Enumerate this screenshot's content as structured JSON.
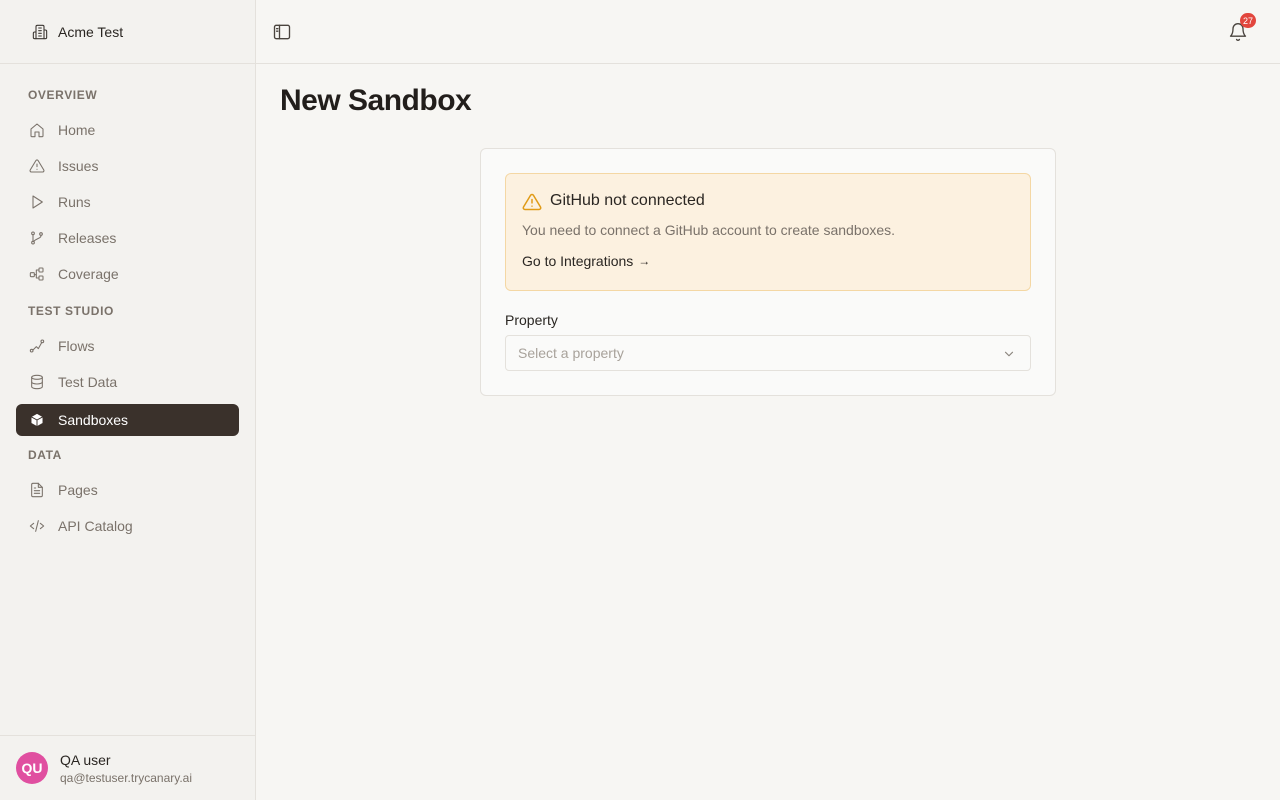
{
  "workspace": {
    "name": "Acme Test"
  },
  "sidebar": {
    "sections": [
      {
        "label": "OVERVIEW",
        "items": [
          {
            "label": "Home",
            "icon": "home-icon"
          },
          {
            "label": "Issues",
            "icon": "warning-icon"
          },
          {
            "label": "Runs",
            "icon": "play-icon"
          },
          {
            "label": "Releases",
            "icon": "git-branch-icon"
          },
          {
            "label": "Coverage",
            "icon": "workflow-icon"
          }
        ]
      },
      {
        "label": "TEST STUDIO",
        "items": [
          {
            "label": "Flows",
            "icon": "route-icon"
          },
          {
            "label": "Test Data",
            "icon": "database-icon"
          },
          {
            "label": "Sandboxes",
            "icon": "box-icon",
            "active": true
          }
        ]
      },
      {
        "label": "DATA",
        "items": [
          {
            "label": "Pages",
            "icon": "file-text-icon"
          },
          {
            "label": "API Catalog",
            "icon": "code-icon"
          }
        ]
      }
    ]
  },
  "user": {
    "initials": "QU",
    "name": "QA user",
    "email": "qa@testuser.trycanary.ai",
    "avatar_color": "#e04fa0"
  },
  "topbar": {
    "notification_count": "27"
  },
  "main": {
    "title": "New Sandbox",
    "alert": {
      "title": "GitHub not connected",
      "description": "You need to connect a GitHub account to create sandboxes.",
      "link_label": "Go to Integrations",
      "link_arrow": "→"
    },
    "property": {
      "label": "Property",
      "placeholder": "Select a property"
    }
  },
  "colors": {
    "active_nav_bg": "#3a312b",
    "alert_bg": "#fcf1e0",
    "warning": "#e09b17",
    "badge": "#e2463d"
  }
}
